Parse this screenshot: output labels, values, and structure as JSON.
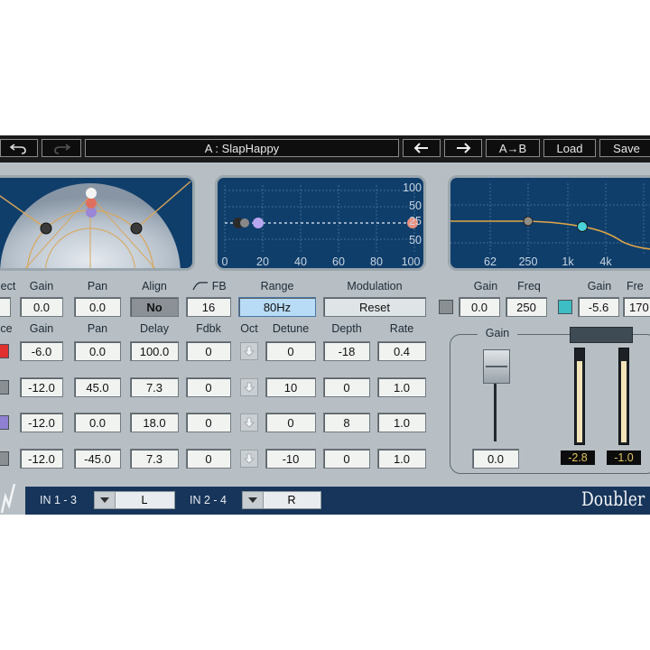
{
  "toolbar": {
    "undo_icon": "undo-icon",
    "redo_icon": "redo-icon",
    "preset": "A : SlapHappy",
    "prev_icon": "arrow-left-icon",
    "next_icon": "arrow-right-icon",
    "ab": "A→B",
    "load": "Load",
    "save": "Save"
  },
  "delay_display": {
    "ticks_x": [
      "0",
      "20",
      "40",
      "60",
      "80",
      "100"
    ],
    "ticks_y": [
      "100",
      "50",
      "25",
      "50",
      "100"
    ]
  },
  "eq_display": {
    "ticks_x": [
      "62",
      "250",
      "1k",
      "4k"
    ]
  },
  "direct": {
    "labels": {
      "direct": "ect",
      "gain": "Gain",
      "pan": "Pan",
      "align": "Align"
    },
    "gain": "0.0",
    "pan": "0.0",
    "align": "No"
  },
  "fb": {
    "label": "FB",
    "value": "16",
    "range_label": "Range",
    "range": "80Hz",
    "modulation_label": "Modulation",
    "reset": "Reset"
  },
  "filter": {
    "labels": {
      "gain1": "Gain",
      "freq1": "Freq",
      "gain2": "Gain",
      "freq2": "Fre"
    },
    "gain1": "0.0",
    "freq1": "250",
    "gain2": "-5.6",
    "freq2": "170"
  },
  "voices_header": {
    "voice": "ce",
    "gain": "Gain",
    "pan": "Pan",
    "delay": "Delay",
    "fdbk": "Fdbk",
    "oct": "Oct",
    "detune": "Detune",
    "depth": "Depth",
    "rate": "Rate"
  },
  "voices": [
    {
      "color": "#e03030",
      "gain": "-6.0",
      "pan": "0.0",
      "delay": "100.0",
      "fdbk": "0",
      "detune": "0",
      "depth": "-18",
      "rate": "0.4"
    },
    {
      "color": "#8a8f93",
      "gain": "-12.0",
      "pan": "45.0",
      "delay": "7.3",
      "fdbk": "0",
      "detune": "10",
      "depth": "0",
      "rate": "1.0"
    },
    {
      "color": "#8f7fd0",
      "gain": "-12.0",
      "pan": "0.0",
      "delay": "18.0",
      "fdbk": "0",
      "detune": "0",
      "depth": "8",
      "rate": "1.0"
    },
    {
      "color": "#8a8f93",
      "gain": "-12.0",
      "pan": "-45.0",
      "delay": "7.3",
      "fdbk": "0",
      "detune": "-10",
      "depth": "0",
      "rate": "1.0"
    }
  ],
  "output": {
    "gain_label": "Gain",
    "gain": "0.0",
    "meter_left": "-2.8",
    "meter_right": "-1.0"
  },
  "routing": {
    "in13_label": "IN 1 - 3",
    "in13": "L",
    "in24_label": "IN 2 - 4",
    "in24": "R"
  },
  "product": "Doubler"
}
